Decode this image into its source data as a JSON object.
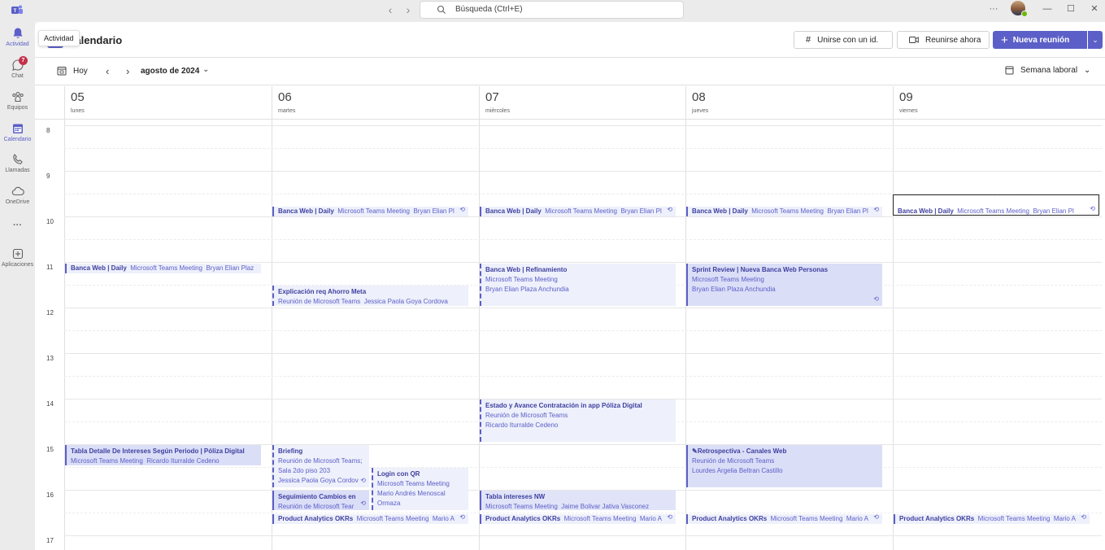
{
  "titlebar": {
    "search_placeholder": "Búsqueda (Ctrl+E)",
    "more": "···"
  },
  "tooltip": "Actividad",
  "rail": [
    {
      "label": "Actividad",
      "icon": "bell-icon",
      "active": false
    },
    {
      "label": "Chat",
      "icon": "chat-icon",
      "badge": "7"
    },
    {
      "label": "Equipos",
      "icon": "teams-icon"
    },
    {
      "label": "Calendario",
      "icon": "calendar-icon",
      "active": true
    },
    {
      "label": "Llamadas",
      "icon": "phone-icon"
    },
    {
      "label": "OneDrive",
      "icon": "cloud-icon"
    },
    {
      "label": "···",
      "icon": "more-icon"
    },
    {
      "label": "Aplicaciones",
      "icon": "apps-icon"
    }
  ],
  "header": {
    "title": "Calendario",
    "join_id": "Unirse con un id.",
    "meet_now": "Reunirse ahora",
    "new_meeting": "Nueva reunión"
  },
  "toolbar": {
    "today": "Hoy",
    "month": "agosto de 2024",
    "view": "Semana laboral"
  },
  "days": [
    {
      "num": "05",
      "name": "lunes"
    },
    {
      "num": "06",
      "name": "martes"
    },
    {
      "num": "07",
      "name": "miércoles"
    },
    {
      "num": "08",
      "name": "jueves"
    },
    {
      "num": "09",
      "name": "viernes"
    }
  ],
  "hours": [
    "8",
    "9",
    "10",
    "11",
    "12",
    "13",
    "14",
    "15",
    "16",
    "17"
  ],
  "events": {
    "daily_06": {
      "title": "Banca Web | Daily",
      "sub": "Microsoft Teams Meeting",
      "org": "Bryan Elian Pl"
    },
    "daily_07": {
      "title": "Banca Web | Daily",
      "sub": "Microsoft Teams Meeting",
      "org": "Bryan Elian Pl"
    },
    "daily_08": {
      "title": "Banca Web | Daily",
      "sub": "Microsoft Teams Meeting",
      "org": "Bryan Elian Pl"
    },
    "daily_09": {
      "title": "Banca Web | Daily",
      "sub": "Microsoft Teams Meeting",
      "org": "Bryan Elian Pl"
    },
    "daily_05": {
      "title": "Banca Web | Daily",
      "sub": "Microsoft Teams Meeting",
      "org": "Bryan Elian Plaz"
    },
    "refinamiento": {
      "title": "Banca Web | Refinamiento",
      "sub": "Microsoft Teams Meeting",
      "org": "Bryan Elian Plaza Anchundia"
    },
    "sprint_review": {
      "title": "Sprint Review | Nueva Banca Web Personas",
      "sub": "Microsoft Teams Meeting",
      "org": "Bryan Elian Plaza Anchundia"
    },
    "ahorro_meta": {
      "title": "Explicación req Ahorro Meta",
      "sub": "Reunión de Microsoft Teams",
      "org": "Jessica Paola Goya Cordova"
    },
    "estado_avance": {
      "title": "Estado y Avance Contratación in app Póliza Digital",
      "sub": "Reunión de Microsoft Teams",
      "org": "Ricardo Iturralde Cedeno"
    },
    "tabla_detalle": {
      "title": "Tabla Detalle De Intereses Según Periodo | Póliza Digital",
      "sub": "Microsoft Teams Meeting",
      "org": "Ricardo Iturralde Cedeno"
    },
    "briefing": {
      "title": "Briefing",
      "sub": "Reunión de Microsoft Teams;",
      "loc": "Sala 2do piso 203",
      "org": "Jessica Paola Goya Cordov"
    },
    "login_qr": {
      "title": "Login con QR",
      "sub": "Microsoft Teams Meeting",
      "org": "Mario Andrés Menoscal",
      "org2": "Ormaza"
    },
    "retro": {
      "title": "Retrospectiva - Canales Web",
      "sub": "Reunión de Microsoft Teams",
      "org": "Lourdes Argelia Beltran Castillo"
    },
    "seguimiento": {
      "title": "Seguimiento Cambios en",
      "sub": "Reunión de Microsoft Tear"
    },
    "tabla_nw": {
      "title": "Tabla intereses NW",
      "sub": "Microsoft Teams Meeting",
      "org": "Jaime Bolivar Jativa Vasconez"
    },
    "okr_06": {
      "title": "Product Analytics OKRs",
      "sub": "Microsoft Teams Meeting",
      "org": "Mario A"
    },
    "okr_07": {
      "title": "Product Analytics OKRs",
      "sub": "Microsoft Teams Meeting",
      "org": "Mario A"
    },
    "okr_08": {
      "title": "Product Analytics OKRs",
      "sub": "Microsoft Teams Meeting",
      "org": "Mario A"
    },
    "okr_09": {
      "title": "Product Analytics OKRs",
      "sub": "Microsoft Teams Meeting",
      "org": "Mario A"
    }
  },
  "colors": {
    "accent": "#5b5fc7",
    "event_bg": "#e1e4f8"
  }
}
